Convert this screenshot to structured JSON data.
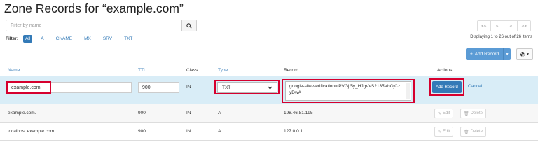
{
  "page": {
    "title": "Zone Records for “example.com”"
  },
  "search": {
    "placeholder": "Filter by name"
  },
  "filter": {
    "label": "Filter:",
    "options": [
      "All",
      "A",
      "CNAME",
      "MX",
      "SRV",
      "TXT"
    ]
  },
  "pager": {
    "first": "<<",
    "prev": "<",
    "next": ">",
    "last": ">>",
    "display_info": "Displaying 1 to 26 out of 26 items"
  },
  "toolbar": {
    "add_record_label": "Add Record",
    "add_record_icon": "plus-icon",
    "settings_icon": "gear-icon"
  },
  "table": {
    "headers": {
      "name": "Name",
      "ttl": "TTL",
      "class": "Class",
      "type": "Type",
      "record": "Record",
      "actions": "Actions"
    },
    "edit_row": {
      "name": "example.com.",
      "ttl": "900",
      "class": "IN",
      "type": "TXT",
      "record": "google-site-verification=iPVGjf5y_HJgVvS2135VhOjCzyDwA",
      "add_button": "Add Record",
      "cancel": "Cancel"
    },
    "rows": [
      {
        "name": "example.com.",
        "ttl": "900",
        "class": "IN",
        "type": "A",
        "record": "198.46.81.195",
        "edit": "Edit",
        "delete": "Delete"
      },
      {
        "name": "localhost.example.com.",
        "ttl": "900",
        "class": "IN",
        "type": "A",
        "record": "127.0.0.1",
        "edit": "Edit",
        "delete": "Delete"
      }
    ]
  },
  "colors": {
    "accent": "#337ab7",
    "highlight": "#d6002e",
    "edit_row_bg": "#d9edf7"
  }
}
